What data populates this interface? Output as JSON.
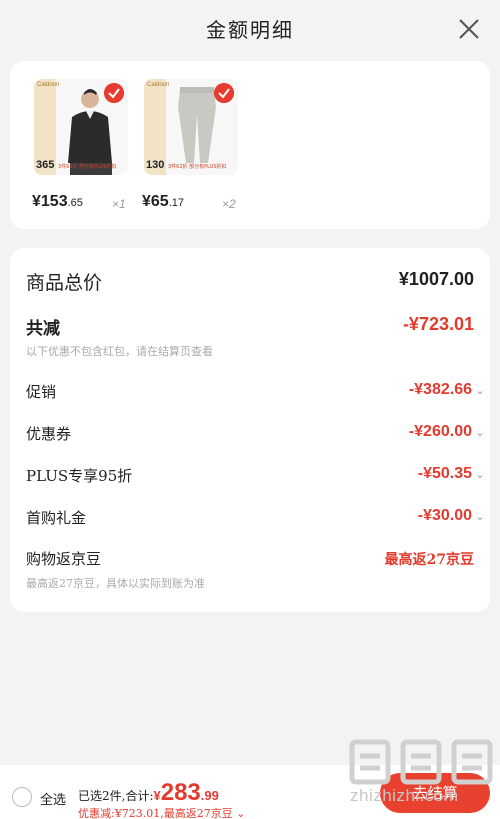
{
  "header": {
    "title": "金额明细",
    "close_icon": "close-icon"
  },
  "products": [
    {
      "brand": "Caldoon",
      "strip_number": "365",
      "promo": "3件62折 部分有PLUS折扣",
      "price_int": "¥153",
      "price_dec": ".65",
      "qty": "×1",
      "image": "man-in-black-jacket"
    },
    {
      "brand": "Caldoon",
      "strip_number": "130",
      "promo": "3件62折 部分有PLUS折扣",
      "price_int": "¥65",
      "price_dec": ".17",
      "qty": "×2",
      "image": "grey-jogger-pants"
    }
  ],
  "summary": {
    "goods_total_label": "商品总价",
    "goods_total_value": "¥1007.00",
    "total_reduce_label": "共减",
    "total_reduce_value": "-¥723.01",
    "total_reduce_note": "以下优惠不包含红包，请在结算页查看",
    "rows": [
      {
        "label": "促销",
        "value": "-¥382.66"
      },
      {
        "label": "优惠券",
        "value": "-¥260.00"
      },
      {
        "label": "PLUS专享95折",
        "value": "-¥50.35"
      },
      {
        "label": "首购礼金",
        "value": "-¥30.00"
      }
    ],
    "jd_bean_label": "购物返京豆",
    "jd_bean_value": "最高返27京豆",
    "jd_bean_note": "最高返27京豆，具体以实际到账为准"
  },
  "bottom": {
    "select_all": "全选",
    "selected_text": "已选2件,合计:",
    "yen": "¥",
    "total_int": "283",
    "total_dec": ".99",
    "discount_text": "优惠减:¥723.01,最高返27京豆",
    "checkout": "去结算"
  },
  "watermark": {
    "text": "zhizhizhi.com"
  },
  "colors": {
    "accent": "#e23b2e",
    "background": "#f3f3f3",
    "card": "#ffffff"
  }
}
